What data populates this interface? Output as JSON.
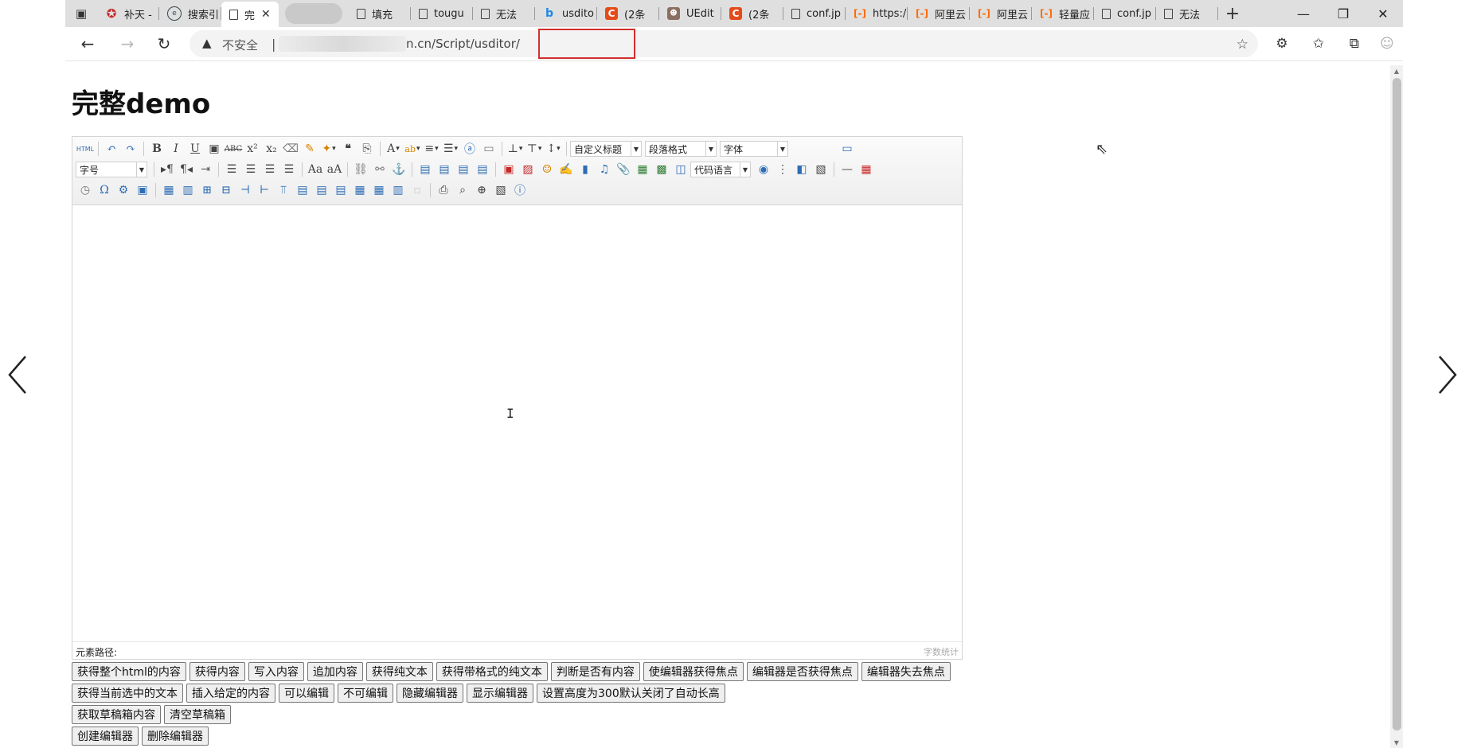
{
  "tabs": [
    {
      "label": "补天 -",
      "icon": "star-logo-icon"
    },
    {
      "label": "搜索引",
      "icon": "search-engine-icon"
    },
    {
      "label": "完",
      "icon": "page-icon",
      "active": true
    },
    {
      "label": "",
      "icon": "",
      "blurred": true
    },
    {
      "label": "填充",
      "icon": "page-icon"
    },
    {
      "label": "tougu",
      "icon": "page-icon"
    },
    {
      "label": "无法",
      "icon": "page-icon"
    },
    {
      "label": "usdito",
      "icon": "bing-icon"
    },
    {
      "label": "(2条",
      "icon": "csdn-icon"
    },
    {
      "label": "UEdit",
      "icon": "avatar-icon"
    },
    {
      "label": "(2条",
      "icon": "csdn-icon"
    },
    {
      "label": "conf.jp",
      "icon": "page-icon"
    },
    {
      "label": "https:/",
      "icon": "aliyun-icon"
    },
    {
      "label": "阿里云",
      "icon": "aliyun-icon"
    },
    {
      "label": "阿里云",
      "icon": "aliyun-icon"
    },
    {
      "label": "轻量应",
      "icon": "aliyun-icon"
    },
    {
      "label": "conf.jp",
      "icon": "page-icon"
    },
    {
      "label": "无法",
      "icon": "page-icon"
    }
  ],
  "address": {
    "insecure_label": "不安全",
    "separator": "|",
    "url": "n.cn/Script/usditor/"
  },
  "page": {
    "title": "完整demo"
  },
  "editor": {
    "combos": {
      "custom_heading": "自定义标题",
      "paragraph_format": "段落格式",
      "font_family": "字体",
      "font_size": "字号",
      "code_language": "代码语言"
    },
    "element_path_label": "元素路径:",
    "word_count_label": "字数统计"
  },
  "buttons": {
    "row1": [
      "获得整个html的内容",
      "获得内容",
      "写入内容",
      "追加内容",
      "获得纯文本",
      "获得带格式的纯文本",
      "判断是否有内容",
      "使编辑器获得焦点",
      "编辑器是否获得焦点",
      "编辑器失去焦点"
    ],
    "row2": [
      "获得当前选中的文本",
      "插入给定的内容",
      "可以编辑",
      "不可编辑",
      "隐藏编辑器",
      "显示编辑器",
      "设置高度为300默认关闭了自动长高"
    ],
    "row3": [
      "获取草稿箱内容",
      "清空草稿箱"
    ],
    "row4": [
      "创建编辑器",
      "删除编辑器"
    ]
  }
}
